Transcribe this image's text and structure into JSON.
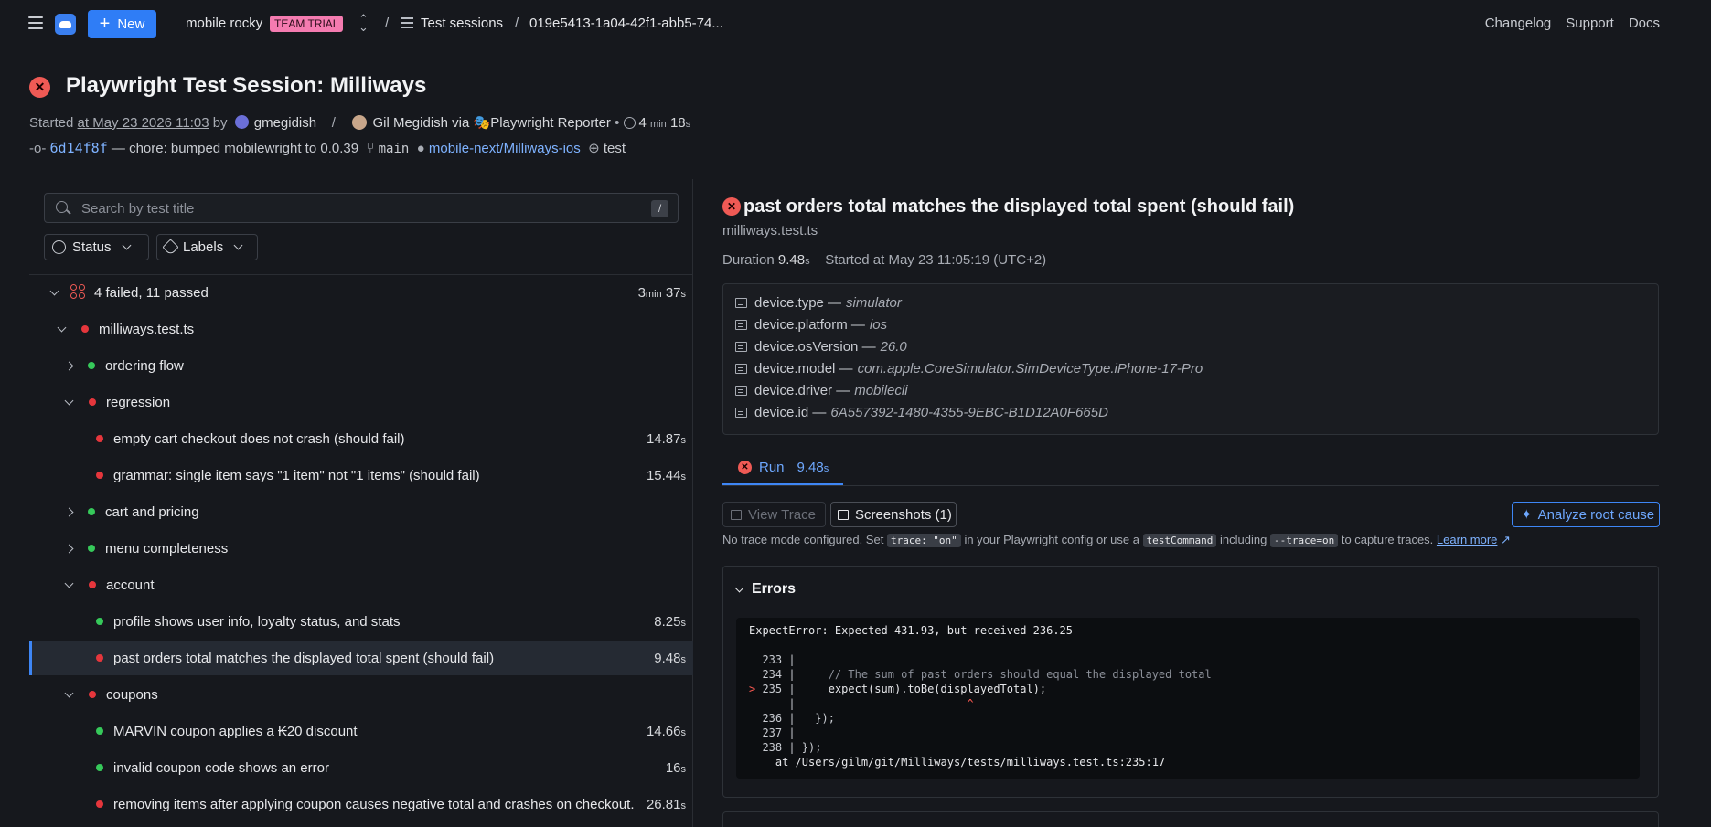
{
  "topbar": {
    "new_label": "New",
    "org_name": "mobile rocky",
    "trial_badge": "TEAM TRIAL",
    "crumb_sep": "/",
    "breadcrumb_sessions": "Test sessions",
    "breadcrumb_session_id": "019e5413-1a04-42f1-abb5-74...",
    "links": [
      "Changelog",
      "Support",
      "Docs"
    ]
  },
  "header": {
    "title": "Playwright Test Session: Milliways",
    "started_prefix": "Started",
    "started_at": "at May 23 2026 11:03",
    "by": "by",
    "user": "gmegidish",
    "sep": "/",
    "author": "Gil Megidish via",
    "reporter": "Playwright Reporter",
    "bullet": "•",
    "duration_min": "4",
    "duration_min_unit": "min",
    "duration_sec": "18",
    "duration_sec_unit": "s",
    "commit_sha": "6d14f8f",
    "commit_msg": "— chore: bumped mobilewright to 0.0.39",
    "branch": "main",
    "repo": "mobile-next/Milliways-ios",
    "environment": "test"
  },
  "left": {
    "search_placeholder": "Search by test title",
    "search_kbd": "/",
    "filter_status": "Status",
    "filter_labels": "Labels",
    "summary": {
      "label": "4 failed, 11 passed",
      "min": "3",
      "min_unit": "min",
      "sec": "37",
      "sec_unit": "s"
    },
    "file": "milliways.test.ts",
    "groups": {
      "ordering": "ordering flow",
      "regression": "regression",
      "cart": "cart and pricing",
      "menu": "menu completeness",
      "account": "account",
      "coupons": "coupons"
    },
    "tests": {
      "t1": {
        "title": "empty cart checkout does not crash (should fail)",
        "dur": "14.87",
        "unit": "s"
      },
      "t2": {
        "title": "grammar: single item says \"1 item\" not \"1 items\" (should fail)",
        "dur": "15.44",
        "unit": "s"
      },
      "t3": {
        "title": "profile shows user info, loyalty status, and stats",
        "dur": "8.25",
        "unit": "s"
      },
      "t4": {
        "title": "past orders total matches the displayed total spent (should fail)",
        "dur": "9.48",
        "unit": "s"
      },
      "t5": {
        "title": "MARVIN coupon applies a ₭20 discount",
        "dur": "14.66",
        "unit": "s"
      },
      "t6": {
        "title": "invalid coupon code shows an error",
        "dur": "16",
        "unit": "s"
      },
      "t7": {
        "title": "removing items after applying coupon causes negative total and crashes on checkout...",
        "dur": "26.81",
        "unit": "s"
      }
    }
  },
  "detail": {
    "title": "past orders total matches the displayed total spent (should fail)",
    "file": "milliways.test.ts",
    "duration_label": "Duration",
    "duration": "9.48",
    "duration_unit": "s",
    "started": "Started at May 23 11:05:19 (UTC+2)",
    "annotations": [
      {
        "key": "device.type —",
        "value": "simulator"
      },
      {
        "key": "device.platform —",
        "value": "ios"
      },
      {
        "key": "device.osVersion —",
        "value": "26.0"
      },
      {
        "key": "device.model —",
        "value": "com.apple.CoreSimulator.SimDeviceType.iPhone-17-Pro"
      },
      {
        "key": "device.driver —",
        "value": "mobilecli"
      },
      {
        "key": "device.id —",
        "value": "6A557392-1480-4355-9EBC-B1D12A0F665D"
      }
    ],
    "run_tab": "Run",
    "run_dur": "9.48",
    "run_unit": "s",
    "view_trace": "View Trace",
    "screenshots": "Screenshots (1)",
    "analyze": "Analyze root cause",
    "trace_note": {
      "p1": "No trace mode configured. Set",
      "c1": "trace: \"on\"",
      "p2": "in your Playwright config or use a",
      "c2": "testCommand",
      "p3": "including",
      "c3": "--trace=on",
      "p4": "to capture traces.",
      "link": "Learn more"
    },
    "errors_title": "Errors",
    "error_message": "ExpectError: Expected 431.93, but received 236.25",
    "code": {
      "l233": "  233 |",
      "l234_n": "  234 |",
      "l234_c": "     // The sum of past orders should equal the displayed total",
      "l235_m": ">",
      "l235_n": " 235 |",
      "l235_c": "     expect(sum).toBe(displayedTotal);",
      "caret_n": "      |",
      "caret": "                          ^",
      "l236": "  236 |   });",
      "l237": "  237 |",
      "l238": "  238 | });",
      "at": "    at /Users/gilm/git/Milliways/tests/milliways.test.ts:235:17"
    }
  }
}
